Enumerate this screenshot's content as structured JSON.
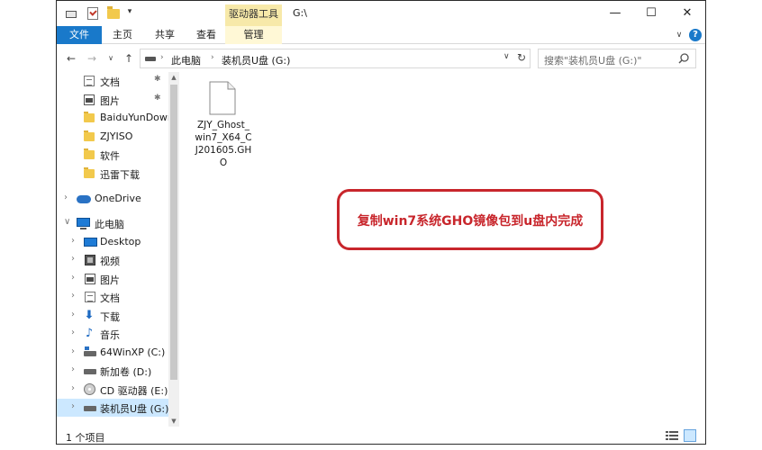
{
  "titlebar": {
    "context_tab": "驱动器工具",
    "path": "G:\\",
    "minimize": "—",
    "maximize": "☐",
    "close": "✕"
  },
  "ribbon": {
    "tabs": [
      "文件",
      "主页",
      "共享",
      "查看",
      "管理"
    ],
    "collapse_glyph": "∨",
    "help_glyph": "?"
  },
  "address": {
    "back_glyph": "←",
    "forward_glyph": "→",
    "recent_glyph": "∨",
    "up_glyph": "↑",
    "crumbs": [
      "此电脑",
      "装机员U盘 (G:)"
    ],
    "separator": "›",
    "dropdown_glyph": "∨",
    "refresh_glyph": "↻",
    "search_placeholder": "搜索\"装机员U盘 (G:)\""
  },
  "navpane": {
    "quick_access": [
      {
        "label": "文档",
        "icon": "document-icon",
        "pinned": true
      },
      {
        "label": "图片",
        "icon": "picture-icon",
        "pinned": true
      },
      {
        "label": "BaiduYunDown",
        "icon": "folder-icon",
        "pinned": false
      },
      {
        "label": "ZJYISO",
        "icon": "folder-icon",
        "pinned": false
      },
      {
        "label": "软件",
        "icon": "folder-icon",
        "pinned": false
      },
      {
        "label": "迅雷下载",
        "icon": "folder-icon",
        "pinned": false
      }
    ],
    "onedrive": "OneDrive",
    "this_pc": "此电脑",
    "pc_items": [
      {
        "label": "Desktop",
        "icon": "desktop-icon"
      },
      {
        "label": "视频",
        "icon": "video-icon"
      },
      {
        "label": "图片",
        "icon": "picture-icon"
      },
      {
        "label": "文档",
        "icon": "document-icon"
      },
      {
        "label": "下载",
        "icon": "download-icon"
      },
      {
        "label": "音乐",
        "icon": "music-icon"
      },
      {
        "label": "64WinXP  (C:)",
        "icon": "system-drive-icon"
      },
      {
        "label": "新加卷 (D:)",
        "icon": "drive-icon"
      },
      {
        "label": "CD 驱动器 (E:)",
        "icon": "cd-drive-icon"
      },
      {
        "label": "装机员U盘 (G:)",
        "icon": "drive-icon",
        "selected": true
      }
    ],
    "pin_glyph": "✱",
    "chevron_right": "›",
    "chevron_down": "∨"
  },
  "content": {
    "file": {
      "name": "ZJY_Ghost_win7_X64_CJ201605.GHO"
    },
    "annotation": "复制win7系统GHO镜像包到u盘内完成"
  },
  "statusbar": {
    "count": "1 个项目"
  },
  "colors": {
    "accent": "#1979ca",
    "selected_bg": "#cce8ff",
    "annotation": "#c8262c",
    "context_tab": "#f7e9a9"
  }
}
